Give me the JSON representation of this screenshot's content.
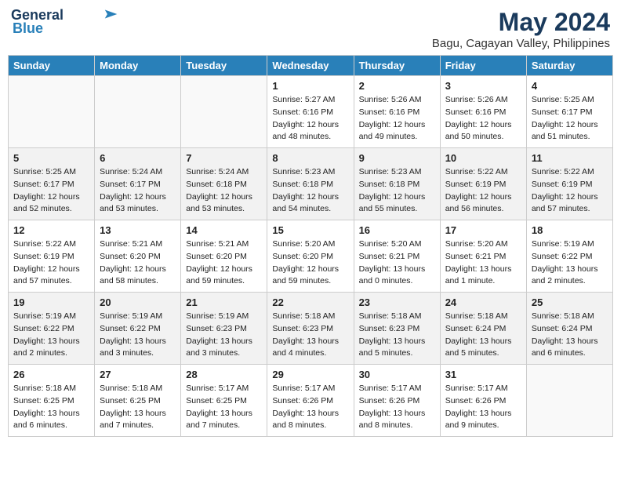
{
  "header": {
    "logo_line1": "General",
    "logo_line2": "Blue",
    "month_year": "May 2024",
    "location": "Bagu, Cagayan Valley, Philippines"
  },
  "weekdays": [
    "Sunday",
    "Monday",
    "Tuesday",
    "Wednesday",
    "Thursday",
    "Friday",
    "Saturday"
  ],
  "weeks": [
    [
      {
        "day": "",
        "info": []
      },
      {
        "day": "",
        "info": []
      },
      {
        "day": "",
        "info": []
      },
      {
        "day": "1",
        "info": [
          "Sunrise: 5:27 AM",
          "Sunset: 6:16 PM",
          "Daylight: 12 hours",
          "and 48 minutes."
        ]
      },
      {
        "day": "2",
        "info": [
          "Sunrise: 5:26 AM",
          "Sunset: 6:16 PM",
          "Daylight: 12 hours",
          "and 49 minutes."
        ]
      },
      {
        "day": "3",
        "info": [
          "Sunrise: 5:26 AM",
          "Sunset: 6:16 PM",
          "Daylight: 12 hours",
          "and 50 minutes."
        ]
      },
      {
        "day": "4",
        "info": [
          "Sunrise: 5:25 AM",
          "Sunset: 6:17 PM",
          "Daylight: 12 hours",
          "and 51 minutes."
        ]
      }
    ],
    [
      {
        "day": "5",
        "info": [
          "Sunrise: 5:25 AM",
          "Sunset: 6:17 PM",
          "Daylight: 12 hours",
          "and 52 minutes."
        ]
      },
      {
        "day": "6",
        "info": [
          "Sunrise: 5:24 AM",
          "Sunset: 6:17 PM",
          "Daylight: 12 hours",
          "and 53 minutes."
        ]
      },
      {
        "day": "7",
        "info": [
          "Sunrise: 5:24 AM",
          "Sunset: 6:18 PM",
          "Daylight: 12 hours",
          "and 53 minutes."
        ]
      },
      {
        "day": "8",
        "info": [
          "Sunrise: 5:23 AM",
          "Sunset: 6:18 PM",
          "Daylight: 12 hours",
          "and 54 minutes."
        ]
      },
      {
        "day": "9",
        "info": [
          "Sunrise: 5:23 AM",
          "Sunset: 6:18 PM",
          "Daylight: 12 hours",
          "and 55 minutes."
        ]
      },
      {
        "day": "10",
        "info": [
          "Sunrise: 5:22 AM",
          "Sunset: 6:19 PM",
          "Daylight: 12 hours",
          "and 56 minutes."
        ]
      },
      {
        "day": "11",
        "info": [
          "Sunrise: 5:22 AM",
          "Sunset: 6:19 PM",
          "Daylight: 12 hours",
          "and 57 minutes."
        ]
      }
    ],
    [
      {
        "day": "12",
        "info": [
          "Sunrise: 5:22 AM",
          "Sunset: 6:19 PM",
          "Daylight: 12 hours",
          "and 57 minutes."
        ]
      },
      {
        "day": "13",
        "info": [
          "Sunrise: 5:21 AM",
          "Sunset: 6:20 PM",
          "Daylight: 12 hours",
          "and 58 minutes."
        ]
      },
      {
        "day": "14",
        "info": [
          "Sunrise: 5:21 AM",
          "Sunset: 6:20 PM",
          "Daylight: 12 hours",
          "and 59 minutes."
        ]
      },
      {
        "day": "15",
        "info": [
          "Sunrise: 5:20 AM",
          "Sunset: 6:20 PM",
          "Daylight: 12 hours",
          "and 59 minutes."
        ]
      },
      {
        "day": "16",
        "info": [
          "Sunrise: 5:20 AM",
          "Sunset: 6:21 PM",
          "Daylight: 13 hours",
          "and 0 minutes."
        ]
      },
      {
        "day": "17",
        "info": [
          "Sunrise: 5:20 AM",
          "Sunset: 6:21 PM",
          "Daylight: 13 hours",
          "and 1 minute."
        ]
      },
      {
        "day": "18",
        "info": [
          "Sunrise: 5:19 AM",
          "Sunset: 6:22 PM",
          "Daylight: 13 hours",
          "and 2 minutes."
        ]
      }
    ],
    [
      {
        "day": "19",
        "info": [
          "Sunrise: 5:19 AM",
          "Sunset: 6:22 PM",
          "Daylight: 13 hours",
          "and 2 minutes."
        ]
      },
      {
        "day": "20",
        "info": [
          "Sunrise: 5:19 AM",
          "Sunset: 6:22 PM",
          "Daylight: 13 hours",
          "and 3 minutes."
        ]
      },
      {
        "day": "21",
        "info": [
          "Sunrise: 5:19 AM",
          "Sunset: 6:23 PM",
          "Daylight: 13 hours",
          "and 3 minutes."
        ]
      },
      {
        "day": "22",
        "info": [
          "Sunrise: 5:18 AM",
          "Sunset: 6:23 PM",
          "Daylight: 13 hours",
          "and 4 minutes."
        ]
      },
      {
        "day": "23",
        "info": [
          "Sunrise: 5:18 AM",
          "Sunset: 6:23 PM",
          "Daylight: 13 hours",
          "and 5 minutes."
        ]
      },
      {
        "day": "24",
        "info": [
          "Sunrise: 5:18 AM",
          "Sunset: 6:24 PM",
          "Daylight: 13 hours",
          "and 5 minutes."
        ]
      },
      {
        "day": "25",
        "info": [
          "Sunrise: 5:18 AM",
          "Sunset: 6:24 PM",
          "Daylight: 13 hours",
          "and 6 minutes."
        ]
      }
    ],
    [
      {
        "day": "26",
        "info": [
          "Sunrise: 5:18 AM",
          "Sunset: 6:25 PM",
          "Daylight: 13 hours",
          "and 6 minutes."
        ]
      },
      {
        "day": "27",
        "info": [
          "Sunrise: 5:18 AM",
          "Sunset: 6:25 PM",
          "Daylight: 13 hours",
          "and 7 minutes."
        ]
      },
      {
        "day": "28",
        "info": [
          "Sunrise: 5:17 AM",
          "Sunset: 6:25 PM",
          "Daylight: 13 hours",
          "and 7 minutes."
        ]
      },
      {
        "day": "29",
        "info": [
          "Sunrise: 5:17 AM",
          "Sunset: 6:26 PM",
          "Daylight: 13 hours",
          "and 8 minutes."
        ]
      },
      {
        "day": "30",
        "info": [
          "Sunrise: 5:17 AM",
          "Sunset: 6:26 PM",
          "Daylight: 13 hours",
          "and 8 minutes."
        ]
      },
      {
        "day": "31",
        "info": [
          "Sunrise: 5:17 AM",
          "Sunset: 6:26 PM",
          "Daylight: 13 hours",
          "and 9 minutes."
        ]
      },
      {
        "day": "",
        "info": []
      }
    ]
  ]
}
